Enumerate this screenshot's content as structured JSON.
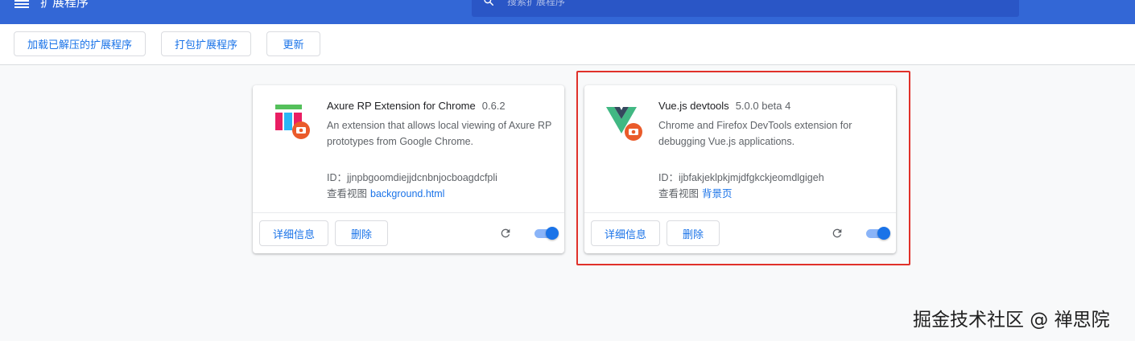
{
  "header": {
    "title": "扩展程序",
    "search_placeholder": "搜索扩展程序"
  },
  "toolbar": {
    "load_unpacked": "加载已解压的扩展程序",
    "pack": "打包扩展程序",
    "update": "更新"
  },
  "extensions": [
    {
      "name": "Axure RP Extension for Chrome",
      "version": "0.6.2",
      "description": "An extension that allows local viewing of Axure RP prototypes from Google Chrome.",
      "id_text": "ID：jjnpbgoomdiejjdcnbnjocboagdcfpli",
      "views_label": "查看视图",
      "view_link": "background.html",
      "details_label": "详细信息",
      "remove_label": "删除",
      "enabled": true
    },
    {
      "name": "Vue.js devtools",
      "version": "5.0.0 beta 4",
      "description": "Chrome and Firefox DevTools extension for debugging Vue.js applications.",
      "id_text": "ID：ijbfakjeklpkjmjdfgkckjeomdlgigeh",
      "views_label": "查看视图",
      "view_link": "背景页",
      "details_label": "详细信息",
      "remove_label": "删除",
      "enabled": true
    }
  ],
  "watermark": "掘金技术社区 @ 禅思院",
  "colors": {
    "header_bg": "#3367d6",
    "accent": "#1a73e8",
    "highlight": "#e0312a"
  }
}
